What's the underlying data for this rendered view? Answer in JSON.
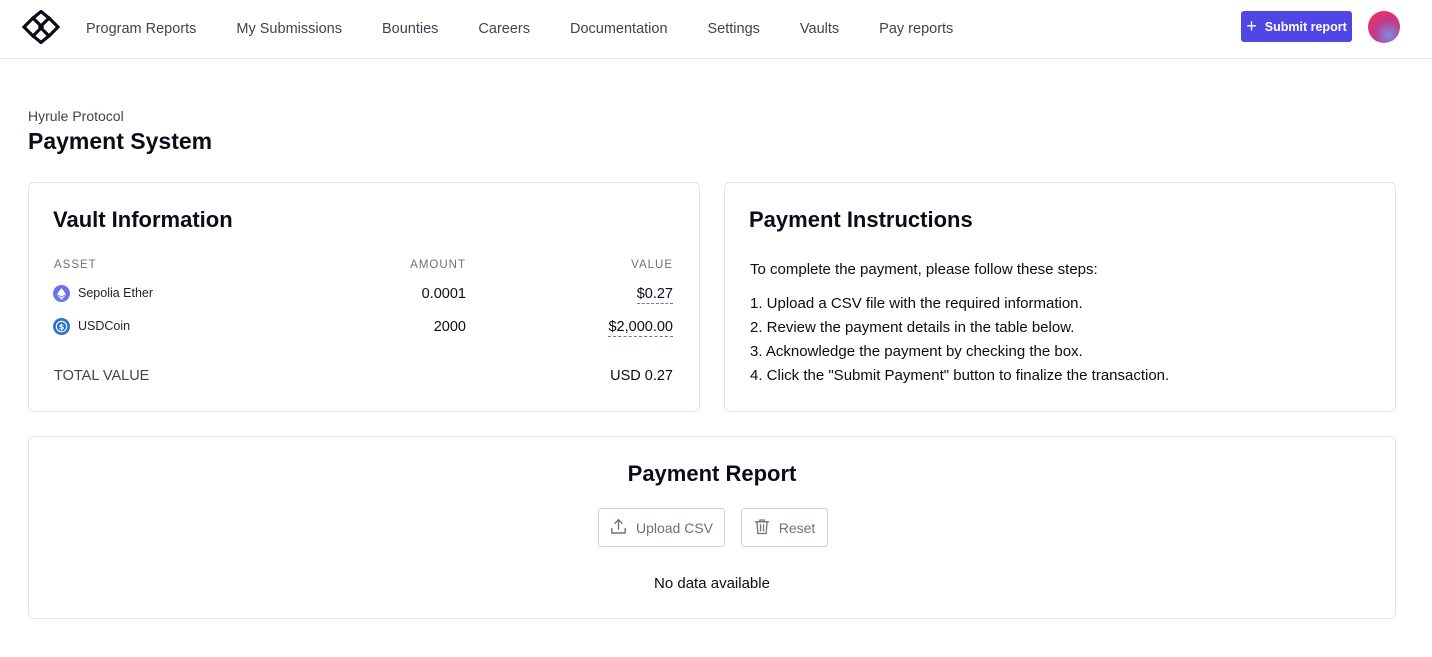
{
  "header": {
    "logo_icon": "hats-finance-logo-icon",
    "nav": [
      {
        "label": "Program Reports"
      },
      {
        "label": "My Submissions"
      },
      {
        "label": "Bounties"
      },
      {
        "label": "Careers"
      },
      {
        "label": "Documentation"
      },
      {
        "label": "Settings"
      },
      {
        "label": "Vaults"
      },
      {
        "label": "Pay reports"
      }
    ],
    "submit_label": "Submit report",
    "submit_icon": "plus-icon",
    "accent_color": "#4f46e5"
  },
  "page": {
    "breadcrumb": "Hyrule Protocol",
    "title": "Payment System"
  },
  "vault": {
    "title": "Vault Information",
    "columns": {
      "asset": "ASSET",
      "amount": "AMOUNT",
      "value": "VALUE"
    },
    "rows": [
      {
        "icon": "ethereum-icon",
        "asset": "Sepolia Ether",
        "amount": "0.0001",
        "value": "$0.27"
      },
      {
        "icon": "usdc-icon",
        "asset": "USDCoin",
        "amount": "2000",
        "value": "$2,000.00"
      }
    ],
    "total_label": "TOTAL VALUE",
    "total_value": "USD 0.27"
  },
  "instructions": {
    "title": "Payment Instructions",
    "intro": "To complete the payment, please follow these steps:",
    "steps": [
      "1. Upload a CSV file with the required information.",
      "2. Review the payment details in the table below.",
      "3. Acknowledge the payment by checking the box.",
      "4. Click the \"Submit Payment\" button to finalize the transaction."
    ]
  },
  "report": {
    "title": "Payment Report",
    "upload_label": "Upload CSV",
    "upload_icon": "upload-icon",
    "reset_label": "Reset",
    "reset_icon": "trash-icon",
    "empty_text": "No data available"
  }
}
